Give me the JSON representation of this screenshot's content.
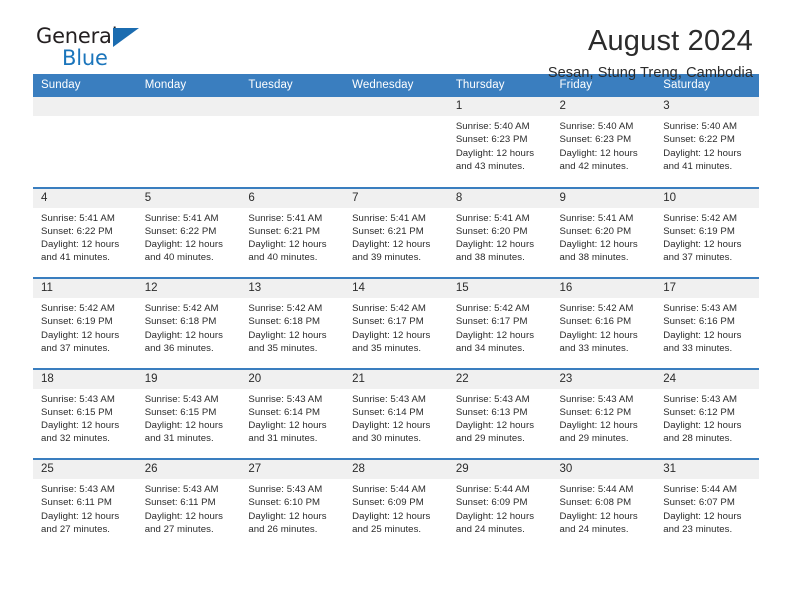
{
  "logo": {
    "word_one": "General",
    "word_two": "Blue",
    "triangle_icon": "triangle-icon",
    "brand_color": "#1b75bb"
  },
  "header": {
    "title": "August 2024",
    "subtitle": "Sesan, Stung Treng, Cambodia"
  },
  "calendar": {
    "header_color": "#3a7ebf",
    "daynum_bg": "#f0f0f0",
    "weekday_headers": [
      "Sunday",
      "Monday",
      "Tuesday",
      "Wednesday",
      "Thursday",
      "Friday",
      "Saturday"
    ],
    "weeks": [
      [
        {
          "day": "",
          "lines": []
        },
        {
          "day": "",
          "lines": []
        },
        {
          "day": "",
          "lines": []
        },
        {
          "day": "",
          "lines": []
        },
        {
          "day": "1",
          "lines": [
            "Sunrise: 5:40 AM",
            "Sunset: 6:23 PM",
            "Daylight: 12 hours",
            "and 43 minutes."
          ]
        },
        {
          "day": "2",
          "lines": [
            "Sunrise: 5:40 AM",
            "Sunset: 6:23 PM",
            "Daylight: 12 hours",
            "and 42 minutes."
          ]
        },
        {
          "day": "3",
          "lines": [
            "Sunrise: 5:40 AM",
            "Sunset: 6:22 PM",
            "Daylight: 12 hours",
            "and 41 minutes."
          ]
        }
      ],
      [
        {
          "day": "4",
          "lines": [
            "Sunrise: 5:41 AM",
            "Sunset: 6:22 PM",
            "Daylight: 12 hours",
            "and 41 minutes."
          ]
        },
        {
          "day": "5",
          "lines": [
            "Sunrise: 5:41 AM",
            "Sunset: 6:22 PM",
            "Daylight: 12 hours",
            "and 40 minutes."
          ]
        },
        {
          "day": "6",
          "lines": [
            "Sunrise: 5:41 AM",
            "Sunset: 6:21 PM",
            "Daylight: 12 hours",
            "and 40 minutes."
          ]
        },
        {
          "day": "7",
          "lines": [
            "Sunrise: 5:41 AM",
            "Sunset: 6:21 PM",
            "Daylight: 12 hours",
            "and 39 minutes."
          ]
        },
        {
          "day": "8",
          "lines": [
            "Sunrise: 5:41 AM",
            "Sunset: 6:20 PM",
            "Daylight: 12 hours",
            "and 38 minutes."
          ]
        },
        {
          "day": "9",
          "lines": [
            "Sunrise: 5:41 AM",
            "Sunset: 6:20 PM",
            "Daylight: 12 hours",
            "and 38 minutes."
          ]
        },
        {
          "day": "10",
          "lines": [
            "Sunrise: 5:42 AM",
            "Sunset: 6:19 PM",
            "Daylight: 12 hours",
            "and 37 minutes."
          ]
        }
      ],
      [
        {
          "day": "11",
          "lines": [
            "Sunrise: 5:42 AM",
            "Sunset: 6:19 PM",
            "Daylight: 12 hours",
            "and 37 minutes."
          ]
        },
        {
          "day": "12",
          "lines": [
            "Sunrise: 5:42 AM",
            "Sunset: 6:18 PM",
            "Daylight: 12 hours",
            "and 36 minutes."
          ]
        },
        {
          "day": "13",
          "lines": [
            "Sunrise: 5:42 AM",
            "Sunset: 6:18 PM",
            "Daylight: 12 hours",
            "and 35 minutes."
          ]
        },
        {
          "day": "14",
          "lines": [
            "Sunrise: 5:42 AM",
            "Sunset: 6:17 PM",
            "Daylight: 12 hours",
            "and 35 minutes."
          ]
        },
        {
          "day": "15",
          "lines": [
            "Sunrise: 5:42 AM",
            "Sunset: 6:17 PM",
            "Daylight: 12 hours",
            "and 34 minutes."
          ]
        },
        {
          "day": "16",
          "lines": [
            "Sunrise: 5:42 AM",
            "Sunset: 6:16 PM",
            "Daylight: 12 hours",
            "and 33 minutes."
          ]
        },
        {
          "day": "17",
          "lines": [
            "Sunrise: 5:43 AM",
            "Sunset: 6:16 PM",
            "Daylight: 12 hours",
            "and 33 minutes."
          ]
        }
      ],
      [
        {
          "day": "18",
          "lines": [
            "Sunrise: 5:43 AM",
            "Sunset: 6:15 PM",
            "Daylight: 12 hours",
            "and 32 minutes."
          ]
        },
        {
          "day": "19",
          "lines": [
            "Sunrise: 5:43 AM",
            "Sunset: 6:15 PM",
            "Daylight: 12 hours",
            "and 31 minutes."
          ]
        },
        {
          "day": "20",
          "lines": [
            "Sunrise: 5:43 AM",
            "Sunset: 6:14 PM",
            "Daylight: 12 hours",
            "and 31 minutes."
          ]
        },
        {
          "day": "21",
          "lines": [
            "Sunrise: 5:43 AM",
            "Sunset: 6:14 PM",
            "Daylight: 12 hours",
            "and 30 minutes."
          ]
        },
        {
          "day": "22",
          "lines": [
            "Sunrise: 5:43 AM",
            "Sunset: 6:13 PM",
            "Daylight: 12 hours",
            "and 29 minutes."
          ]
        },
        {
          "day": "23",
          "lines": [
            "Sunrise: 5:43 AM",
            "Sunset: 6:12 PM",
            "Daylight: 12 hours",
            "and 29 minutes."
          ]
        },
        {
          "day": "24",
          "lines": [
            "Sunrise: 5:43 AM",
            "Sunset: 6:12 PM",
            "Daylight: 12 hours",
            "and 28 minutes."
          ]
        }
      ],
      [
        {
          "day": "25",
          "lines": [
            "Sunrise: 5:43 AM",
            "Sunset: 6:11 PM",
            "Daylight: 12 hours",
            "and 27 minutes."
          ]
        },
        {
          "day": "26",
          "lines": [
            "Sunrise: 5:43 AM",
            "Sunset: 6:11 PM",
            "Daylight: 12 hours",
            "and 27 minutes."
          ]
        },
        {
          "day": "27",
          "lines": [
            "Sunrise: 5:43 AM",
            "Sunset: 6:10 PM",
            "Daylight: 12 hours",
            "and 26 minutes."
          ]
        },
        {
          "day": "28",
          "lines": [
            "Sunrise: 5:44 AM",
            "Sunset: 6:09 PM",
            "Daylight: 12 hours",
            "and 25 minutes."
          ]
        },
        {
          "day": "29",
          "lines": [
            "Sunrise: 5:44 AM",
            "Sunset: 6:09 PM",
            "Daylight: 12 hours",
            "and 24 minutes."
          ]
        },
        {
          "day": "30",
          "lines": [
            "Sunrise: 5:44 AM",
            "Sunset: 6:08 PM",
            "Daylight: 12 hours",
            "and 24 minutes."
          ]
        },
        {
          "day": "31",
          "lines": [
            "Sunrise: 5:44 AM",
            "Sunset: 6:07 PM",
            "Daylight: 12 hours",
            "and 23 minutes."
          ]
        }
      ]
    ]
  }
}
